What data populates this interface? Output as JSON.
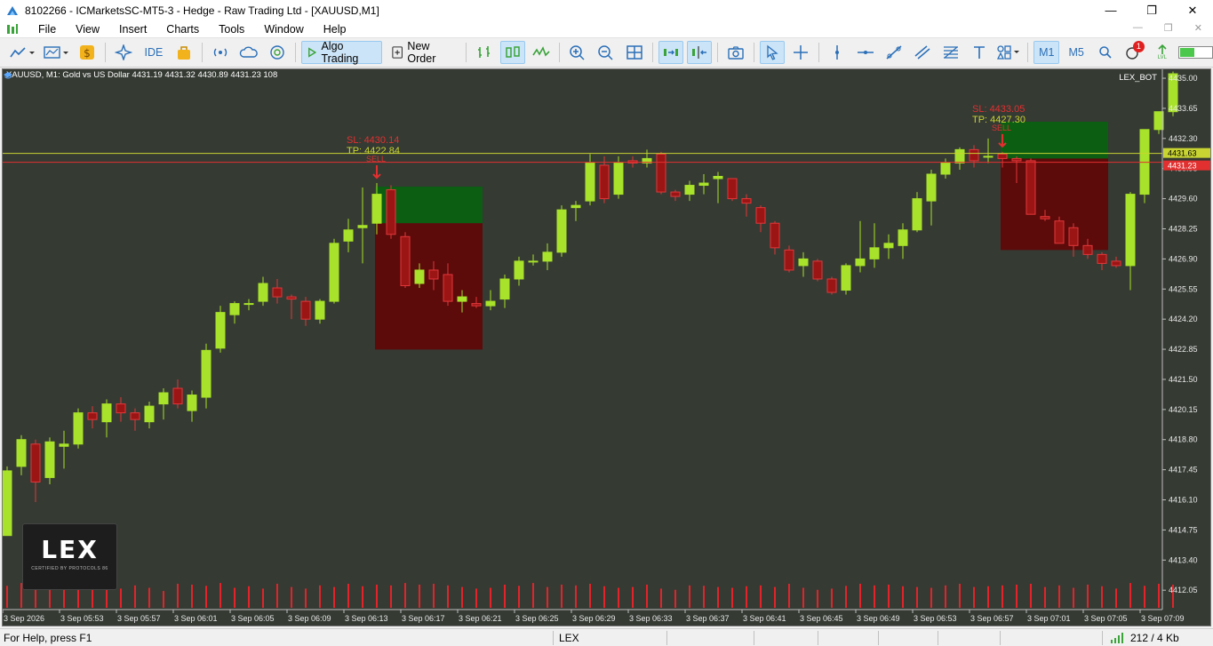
{
  "window": {
    "title": "8102266 - ICMarketsSC-MT5-3 - Hedge - Raw Trading Ltd - [XAUUSD,M1]",
    "minimize": "—",
    "maximize": "❐",
    "close": "✕"
  },
  "menu": {
    "items": [
      "File",
      "View",
      "Insert",
      "Charts",
      "Tools",
      "Window",
      "Help"
    ],
    "mdi": [
      "—",
      "❐",
      "✕"
    ]
  },
  "toolbar": {
    "ide_label": "IDE",
    "algo_trading_label": "Algo Trading",
    "new_order_label": "New Order",
    "timeframe_m1": "M1",
    "timeframe_m5": "M5",
    "notification_count": "1",
    "lvl_label": "LVL"
  },
  "chart": {
    "info": "XAUUSD, M1:  Gold vs US Dollar  4431.19 4431.32 4430.89 4431.23  108",
    "ea_name": "LEX_BOT",
    "ask_line_label": "4431.63",
    "bid_line_label": "4431.23",
    "signals": [
      {
        "sl": "SL: 4430.14",
        "tp": "TP: 4422.84",
        "type": "SELL"
      },
      {
        "sl": "SL: 4433.05",
        "tp": "TP: 4427.30",
        "type": "SELL"
      }
    ],
    "colors": {
      "background": "#353a33",
      "bull": "#a8e22a",
      "bear": "#e2383a",
      "tp_zone": "#0b5e12",
      "sl_zone": "#5c0a0a",
      "ask_line": "#c8d432",
      "bid_line": "#e23030",
      "volume": "#e3232a"
    }
  },
  "chart_data": {
    "type": "candlestick",
    "symbol": "XAUUSD",
    "timeframe": "M1",
    "y_ticks": [
      "4435.00",
      "4433.65",
      "4432.30",
      "4430.95",
      "4429.60",
      "4428.25",
      "4426.90",
      "4425.55",
      "4424.20",
      "4422.85",
      "4421.50",
      "4420.15",
      "4418.80",
      "4417.45",
      "4416.10",
      "4414.75",
      "4413.40",
      "4412.05"
    ],
    "x_ticks": [
      "3 Sep 2026",
      "3 Sep 05:53",
      "3 Sep 05:57",
      "3 Sep 06:01",
      "3 Sep 06:05",
      "3 Sep 06:09",
      "3 Sep 06:13",
      "3 Sep 06:17",
      "3 Sep 06:21",
      "3 Sep 06:25",
      "3 Sep 06:29",
      "3 Sep 06:33",
      "3 Sep 06:37",
      "3 Sep 06:41",
      "3 Sep 06:45",
      "3 Sep 06:49",
      "3 Sep 06:53",
      "3 Sep 06:57",
      "3 Sep 07:01",
      "3 Sep 07:05",
      "3 Sep 07:09"
    ],
    "ylim": [
      4411.5,
      4435.4
    ],
    "candles": [
      [
        4414.5,
        4417.6,
        4414.5,
        4417.4
      ],
      [
        4417.6,
        4419.0,
        4417.2,
        4418.8
      ],
      [
        4418.6,
        4418.8,
        4416.0,
        4416.9
      ],
      [
        4417.1,
        4418.9,
        4416.8,
        4418.7
      ],
      [
        4418.5,
        4419.2,
        4417.5,
        4418.6
      ],
      [
        4418.6,
        4420.2,
        4418.4,
        4420.0
      ],
      [
        4420.0,
        4420.3,
        4419.3,
        4419.7
      ],
      [
        4419.6,
        4420.6,
        4418.9,
        4420.4
      ],
      [
        4420.4,
        4420.7,
        4419.6,
        4420.0
      ],
      [
        4420.0,
        4420.2,
        4419.2,
        4419.7
      ],
      [
        4419.6,
        4420.5,
        4419.3,
        4420.3
      ],
      [
        4420.4,
        4421.1,
        4419.7,
        4420.9
      ],
      [
        4421.1,
        4421.5,
        4420.2,
        4420.4
      ],
      [
        4420.1,
        4421.0,
        4419.6,
        4420.8
      ],
      [
        4420.7,
        4423.1,
        4420.2,
        4422.8
      ],
      [
        4422.9,
        4424.8,
        4422.7,
        4424.5
      ],
      [
        4424.4,
        4425.0,
        4424.0,
        4424.9
      ],
      [
        4424.9,
        4425.1,
        4424.6,
        4424.9
      ],
      [
        4425.0,
        4426.1,
        4424.8,
        4425.8
      ],
      [
        4425.6,
        4426.0,
        4424.9,
        4425.2
      ],
      [
        4425.2,
        4425.3,
        4424.2,
        4425.1
      ],
      [
        4425.0,
        4425.2,
        4423.9,
        4424.2
      ],
      [
        4424.2,
        4425.1,
        4424.0,
        4425.0
      ],
      [
        4425.0,
        4427.8,
        4424.9,
        4427.6
      ],
      [
        4427.7,
        4428.7,
        4427.2,
        4428.2
      ],
      [
        4428.3,
        4430.1,
        4426.7,
        4428.4
      ],
      [
        4428.5,
        4430.3,
        4428.0,
        4429.8
      ],
      [
        4430.0,
        4430.2,
        4427.8,
        4428.0
      ],
      [
        4427.9,
        4428.1,
        4425.6,
        4425.7
      ],
      [
        4425.8,
        4426.7,
        4425.6,
        4426.4
      ],
      [
        4426.4,
        4426.8,
        4425.5,
        4426.0
      ],
      [
        4426.2,
        4426.7,
        4424.8,
        4425.0
      ],
      [
        4425.0,
        4425.5,
        4424.5,
        4425.2
      ],
      [
        4424.9,
        4425.2,
        4424.7,
        4424.8
      ],
      [
        4424.8,
        4425.5,
        4424.6,
        4425.0
      ],
      [
        4425.1,
        4426.2,
        4424.7,
        4426.0
      ],
      [
        4426.0,
        4427.0,
        4425.7,
        4426.8
      ],
      [
        4426.8,
        4427.1,
        4426.6,
        4426.8
      ],
      [
        4426.8,
        4427.6,
        4426.4,
        4427.2
      ],
      [
        4427.2,
        4429.3,
        4427.0,
        4429.1
      ],
      [
        4429.2,
        4429.5,
        4428.6,
        4429.3
      ],
      [
        4429.5,
        4431.6,
        4429.3,
        4431.2
      ],
      [
        4431.1,
        4431.5,
        4429.4,
        4429.6
      ],
      [
        4429.8,
        4431.5,
        4429.6,
        4431.2
      ],
      [
        4431.3,
        4431.5,
        4431.0,
        4431.2
      ],
      [
        4431.2,
        4431.8,
        4431.0,
        4431.4
      ],
      [
        4431.6,
        4431.7,
        4429.8,
        4429.9
      ],
      [
        4429.9,
        4430.0,
        4429.5,
        4429.7
      ],
      [
        4429.8,
        4430.4,
        4429.5,
        4430.2
      ],
      [
        4430.2,
        4430.7,
        4429.8,
        4430.3
      ],
      [
        4430.5,
        4430.8,
        4429.4,
        4430.6
      ],
      [
        4430.5,
        4430.5,
        4429.5,
        4429.6
      ],
      [
        4429.6,
        4429.8,
        4428.8,
        4429.4
      ],
      [
        4429.2,
        4429.3,
        4428.1,
        4428.5
      ],
      [
        4428.5,
        4428.6,
        4427.1,
        4427.4
      ],
      [
        4427.3,
        4427.5,
        4426.3,
        4426.4
      ],
      [
        4426.6,
        4427.2,
        4426.1,
        4426.9
      ],
      [
        4426.8,
        4426.9,
        4425.9,
        4426.0
      ],
      [
        4426.0,
        4426.1,
        4425.3,
        4425.4
      ],
      [
        4425.5,
        4426.7,
        4425.3,
        4426.6
      ],
      [
        4426.6,
        4428.6,
        4426.3,
        4426.9
      ],
      [
        4426.9,
        4428.5,
        4426.5,
        4427.4
      ],
      [
        4427.4,
        4428.0,
        4426.9,
        4427.6
      ],
      [
        4427.5,
        4428.5,
        4426.9,
        4428.2
      ],
      [
        4428.2,
        4429.9,
        4428.1,
        4429.6
      ],
      [
        4429.5,
        4430.9,
        4428.4,
        4430.7
      ],
      [
        4430.7,
        4431.4,
        4430.5,
        4431.2
      ],
      [
        4431.2,
        4431.9,
        4430.9,
        4431.8
      ],
      [
        4431.8,
        4432.0,
        4431.0,
        4431.3
      ],
      [
        4431.5,
        4432.3,
        4431.2,
        4431.5
      ],
      [
        4431.6,
        4431.7,
        4431.0,
        4431.4
      ],
      [
        4431.4,
        4431.5,
        4430.3,
        4431.3
      ],
      [
        4431.3,
        4431.4,
        4428.9,
        4428.9
      ],
      [
        4428.8,
        4429.1,
        4428.6,
        4428.7
      ],
      [
        4428.6,
        4428.8,
        4427.6,
        4427.6
      ],
      [
        4428.3,
        4428.5,
        4427.0,
        4427.5
      ],
      [
        4427.5,
        4427.8,
        4426.9,
        4427.1
      ],
      [
        4427.1,
        4427.2,
        4426.4,
        4426.7
      ],
      [
        4426.8,
        4427.0,
        4426.5,
        4426.6
      ],
      [
        4426.6,
        4429.9,
        4425.5,
        4429.8
      ],
      [
        4429.8,
        4432.6,
        4429.4,
        4432.7
      ],
      [
        4432.7,
        4433.5,
        4432.5,
        4433.5
      ],
      [
        4433.5,
        4435.3,
        4433.3,
        4435.2
      ]
    ],
    "volumes": [
      0.55,
      0.62,
      0.58,
      0.6,
      0.5,
      0.55,
      0.52,
      0.6,
      0.48,
      0.56,
      0.5,
      0.42,
      0.6,
      0.58,
      0.55,
      0.62,
      0.5,
      0.54,
      0.48,
      0.6,
      0.52,
      0.48,
      0.56,
      0.52,
      0.6,
      0.54,
      0.58,
      0.56,
      0.62,
      0.58,
      0.6,
      0.56,
      0.52,
      0.48,
      0.5,
      0.58,
      0.55,
      0.62,
      0.52,
      0.58,
      0.56,
      0.6,
      0.54,
      0.5,
      0.52,
      0.58,
      0.48,
      0.45,
      0.56,
      0.55,
      0.52,
      0.5,
      0.54,
      0.56,
      0.52,
      0.6,
      0.5,
      0.45,
      0.48,
      0.55,
      0.6,
      0.56,
      0.58,
      0.54,
      0.52,
      0.5,
      0.56,
      0.6,
      0.52,
      0.54,
      0.56,
      0.58,
      0.6,
      0.52,
      0.56,
      0.5,
      0.58,
      0.54,
      0.48,
      0.62,
      0.55,
      0.6,
      0.58
    ],
    "ask": 4431.63,
    "bid": 4431.23,
    "trade_boxes": [
      {
        "candle_start": 26,
        "candle_end": 33,
        "entry": 4428.5,
        "sl": 4430.14,
        "tp": 4422.84
      },
      {
        "candle_start": 70,
        "candle_end": 77,
        "entry": 4431.4,
        "sl": 4433.05,
        "tp": 4427.3
      }
    ],
    "grid": false
  },
  "logo": {
    "text": "LEX",
    "subtitle": "CERTIFIED BY PROTOCOLS 86"
  },
  "status": {
    "help": "For Help, press F1",
    "profile": "LEX",
    "network": "212 / 4 Kb"
  }
}
